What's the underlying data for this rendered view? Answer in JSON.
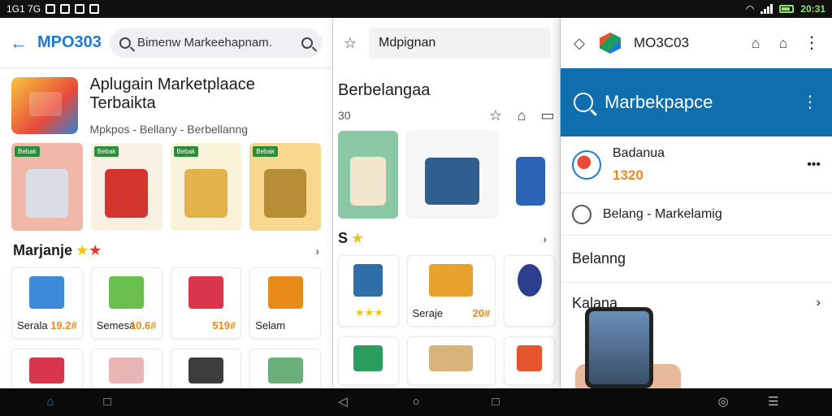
{
  "status_bar": {
    "left_icons": [
      "notification-icon",
      "image-icon",
      "game-icon",
      "app-icon",
      "image-icon"
    ],
    "left_text": "1G1 7G",
    "time": "20:31"
  },
  "pane1": {
    "app_title": "MPO303",
    "search_placeholder": "Bimenw Markeehapnam.",
    "hero": {
      "title": "Aplugain Marketplaace Terbaikta",
      "subtitle": "Mpkpos - Bellany - Berbellanng"
    },
    "featured_tiles": [
      {
        "badge": "Bebak",
        "color": "#f1b7a9"
      },
      {
        "badge": "Bebak",
        "color": "#f9f0e4"
      },
      {
        "badge": "Bebak",
        "color": "#fbf3d9"
      },
      {
        "badge": "Bebak",
        "color": "#f8d88f"
      }
    ],
    "section_title": "Marjanje",
    "products": [
      {
        "name": "Serala",
        "price": "19.2#"
      },
      {
        "name": "Semesa",
        "price": "10.6#"
      },
      {
        "name": "",
        "price": "519#"
      },
      {
        "name": "Selam",
        "price": ""
      }
    ]
  },
  "pane2": {
    "search_text": "Mdpignan",
    "heading": "Berbelangaa",
    "count": "30",
    "section_title": "S",
    "products": [
      {
        "name": "",
        "price": ""
      },
      {
        "name": "",
        "price": ""
      },
      {
        "name": "Seraje",
        "price": "20#"
      },
      {
        "name": "",
        "price": ""
      }
    ]
  },
  "pane3": {
    "app_title": "MO3C03",
    "header_title": "Marbekpapce",
    "list": [
      {
        "title": "Badanua",
        "price": "1320"
      },
      {
        "title": "Belang - Markelamig"
      },
      {
        "title": "Belanng"
      },
      {
        "title": "Kalana"
      }
    ]
  },
  "colors": {
    "accent": "#1c7bd4",
    "header_blue": "#0f6fae",
    "price_orange": "#e88b1b",
    "star_yellow": "#f1c40f"
  }
}
